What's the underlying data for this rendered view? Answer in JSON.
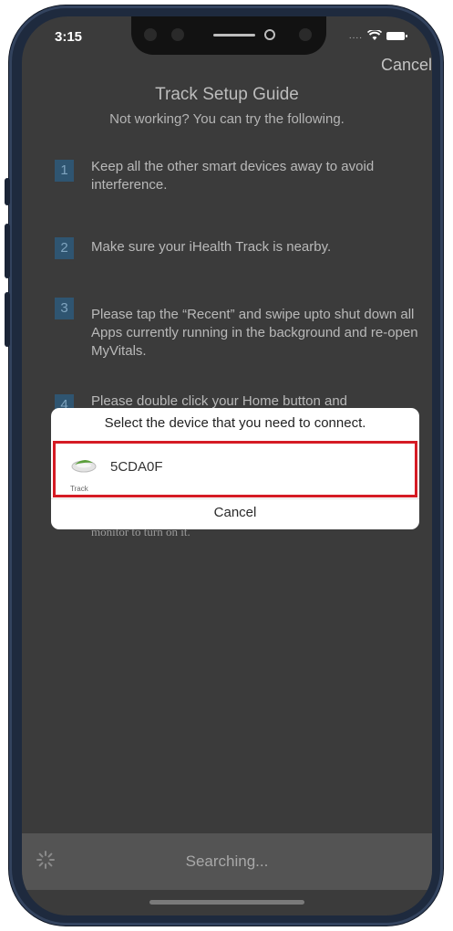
{
  "status_bar": {
    "time": "3:15",
    "signal": "....",
    "wifi_icon": "wifi-icon",
    "battery_icon": "battery-icon"
  },
  "header": {
    "cancel_label": "Cancel",
    "title": "Track Setup Guide",
    "subtitle": "Not working? You can try the following."
  },
  "steps": [
    {
      "num": "1",
      "text": "Keep all the other smart devices away to avoid interference."
    },
    {
      "num": "2",
      "text": "Make sure your iHealth Track is nearby."
    },
    {
      "num": "3",
      "text": "Please tap the “Recent” and swipe upto shut down all Apps currently running in the background and re-open MyVitals."
    },
    {
      "num": "4",
      "text": "Please double click your Home button and"
    }
  ],
  "behind_dialog_text": "monitor to turn on it.",
  "dialog": {
    "title": "Select the device that you need to connect.",
    "device": {
      "name": "5CDA0F",
      "type": "Track",
      "icon": "monitor-device-icon"
    },
    "cancel_label": "Cancel"
  },
  "search": {
    "label": "Searching...",
    "icon": "loading-spinner-icon"
  },
  "colors": {
    "highlight": "#d51b24",
    "step_badge": "#2f5571",
    "screen_bg": "#3b3b3b"
  }
}
